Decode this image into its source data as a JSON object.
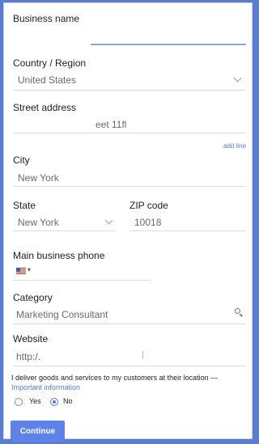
{
  "form": {
    "business_name": {
      "label": "Business name",
      "value": ""
    },
    "country": {
      "label": "Country / Region",
      "value": "United States"
    },
    "street": {
      "label": "Street address",
      "value": "eet 11fl"
    },
    "add_line": "add line",
    "city": {
      "label": "City",
      "value": "New York"
    },
    "state": {
      "label": "State",
      "value": "New York"
    },
    "zip": {
      "label": "ZIP code",
      "value": "10018"
    },
    "phone": {
      "label": "Main business phone",
      "flag_caret": "▾"
    },
    "category": {
      "label": "Category",
      "value": "Marketing Consultant"
    },
    "website": {
      "label": "Website",
      "value": "http:/."
    },
    "deliver": {
      "text": "I deliver goods and services to my customers at their location —",
      "link": "Important information",
      "options": [
        {
          "label": "Yes",
          "checked": false
        },
        {
          "label": "No",
          "checked": true
        }
      ]
    },
    "continue_label": "Continue"
  },
  "colors": {
    "accent": "#5e82e8",
    "frame": "#5a7dd0"
  }
}
